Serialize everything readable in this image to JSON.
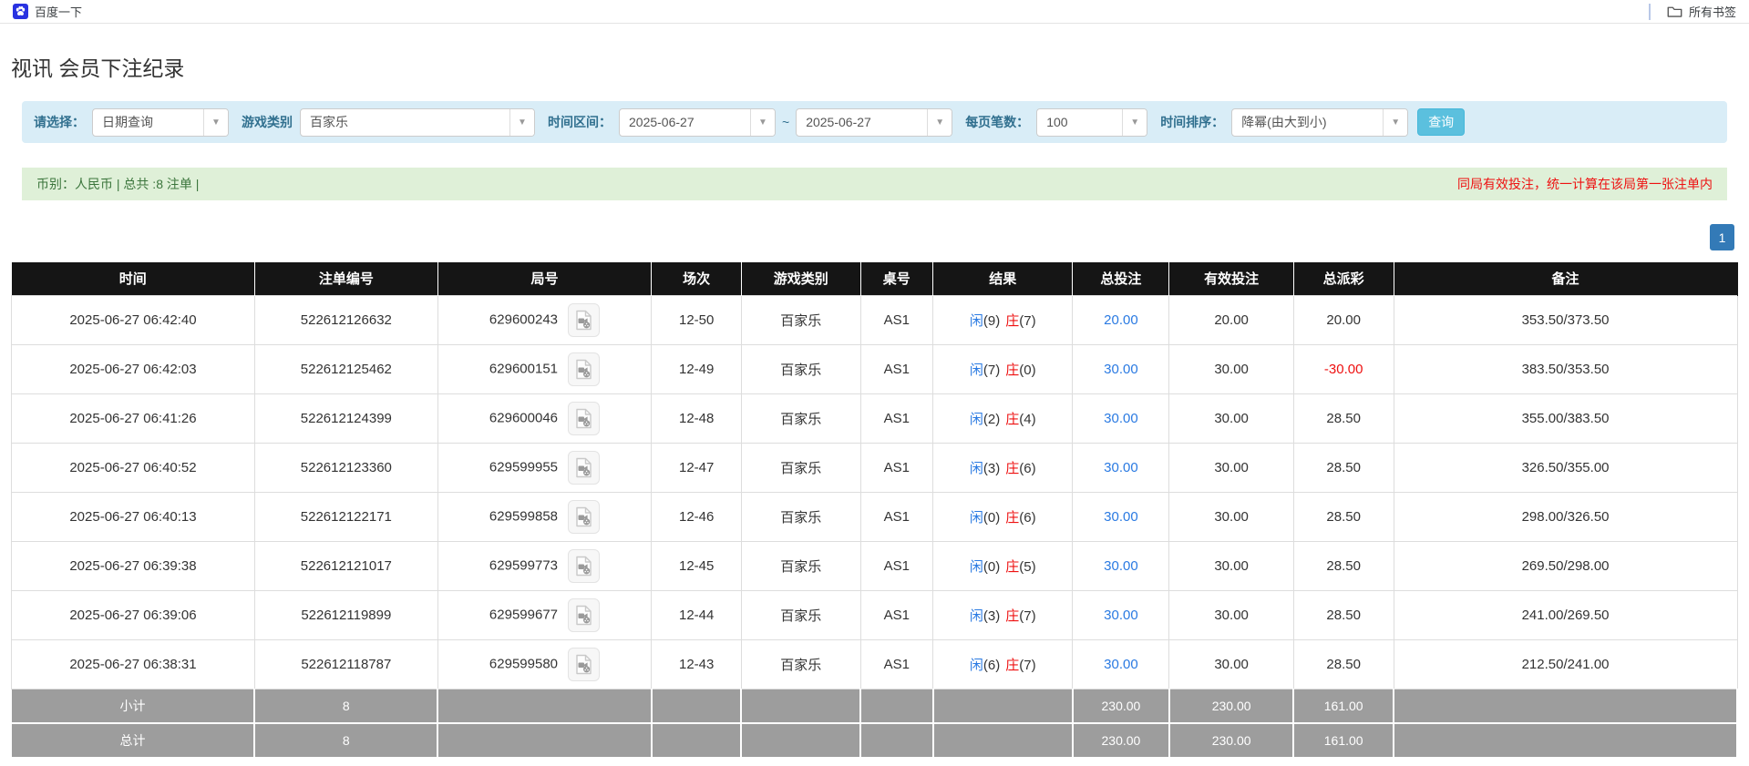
{
  "browser": {
    "bookmark_label": "百度一下",
    "all_bookmarks_label": "所有书签"
  },
  "page": {
    "title": "视讯 会员下注纪录"
  },
  "filters": {
    "select_label": "请选择：",
    "select_value": "日期查询",
    "game_type_label": "游戏类别",
    "game_type_value": "百家乐",
    "date_range_label": "时间区间：",
    "date_from": "2025-06-27",
    "date_separator": "~",
    "date_to": "2025-06-27",
    "page_size_label": "每页笔数：",
    "page_size_value": "100",
    "sort_label": "时间排序：",
    "sort_value": "降幂(由大到小)",
    "search_button_label": "查询"
  },
  "summary": {
    "left_text": "币别：人民币 | 总共 :8 注单 |",
    "right_text": "同局有效投注，统一计算在该局第一张注单内"
  },
  "pagination": {
    "current_page": "1"
  },
  "table": {
    "headers": [
      "时间",
      "注单编号",
      "局号",
      "场次",
      "游戏类别",
      "桌号",
      "结果",
      "总投注",
      "有效投注",
      "总派彩",
      "备注"
    ],
    "rows": [
      {
        "time": "2025-06-27 06:42:40",
        "bet_id": "522612126632",
        "round_id": "629600243",
        "session": "12-50",
        "game": "百家乐",
        "table": "AS1",
        "result": {
          "player_label": "闲",
          "player_score": "(9)",
          "banker_label": "庄",
          "banker_score": "(7)"
        },
        "total_bet": "20.00",
        "valid_bet": "20.00",
        "payout": "20.00",
        "remark": "353.50/373.50"
      },
      {
        "time": "2025-06-27 06:42:03",
        "bet_id": "522612125462",
        "round_id": "629600151",
        "session": "12-49",
        "game": "百家乐",
        "table": "AS1",
        "result": {
          "player_label": "闲",
          "player_score": "(7)",
          "banker_label": "庄",
          "banker_score": "(0)"
        },
        "total_bet": "30.00",
        "valid_bet": "30.00",
        "payout": "-30.00",
        "remark": "383.50/353.50"
      },
      {
        "time": "2025-06-27 06:41:26",
        "bet_id": "522612124399",
        "round_id": "629600046",
        "session": "12-48",
        "game": "百家乐",
        "table": "AS1",
        "result": {
          "player_label": "闲",
          "player_score": "(2)",
          "banker_label": "庄",
          "banker_score": "(4)"
        },
        "total_bet": "30.00",
        "valid_bet": "30.00",
        "payout": "28.50",
        "remark": "355.00/383.50"
      },
      {
        "time": "2025-06-27 06:40:52",
        "bet_id": "522612123360",
        "round_id": "629599955",
        "session": "12-47",
        "game": "百家乐",
        "table": "AS1",
        "result": {
          "player_label": "闲",
          "player_score": "(3)",
          "banker_label": "庄",
          "banker_score": "(6)"
        },
        "total_bet": "30.00",
        "valid_bet": "30.00",
        "payout": "28.50",
        "remark": "326.50/355.00"
      },
      {
        "time": "2025-06-27 06:40:13",
        "bet_id": "522612122171",
        "round_id": "629599858",
        "session": "12-46",
        "game": "百家乐",
        "table": "AS1",
        "result": {
          "player_label": "闲",
          "player_score": "(0)",
          "banker_label": "庄",
          "banker_score": "(6)"
        },
        "total_bet": "30.00",
        "valid_bet": "30.00",
        "payout": "28.50",
        "remark": "298.00/326.50"
      },
      {
        "time": "2025-06-27 06:39:38",
        "bet_id": "522612121017",
        "round_id": "629599773",
        "session": "12-45",
        "game": "百家乐",
        "table": "AS1",
        "result": {
          "player_label": "闲",
          "player_score": "(0)",
          "banker_label": "庄",
          "banker_score": "(5)"
        },
        "total_bet": "30.00",
        "valid_bet": "30.00",
        "payout": "28.50",
        "remark": "269.50/298.00"
      },
      {
        "time": "2025-06-27 06:39:06",
        "bet_id": "522612119899",
        "round_id": "629599677",
        "session": "12-44",
        "game": "百家乐",
        "table": "AS1",
        "result": {
          "player_label": "闲",
          "player_score": "(3)",
          "banker_label": "庄",
          "banker_score": "(7)"
        },
        "total_bet": "30.00",
        "valid_bet": "30.00",
        "payout": "28.50",
        "remark": "241.00/269.50"
      },
      {
        "time": "2025-06-27 06:38:31",
        "bet_id": "522612118787",
        "round_id": "629599580",
        "session": "12-43",
        "game": "百家乐",
        "table": "AS1",
        "result": {
          "player_label": "闲",
          "player_score": "(6)",
          "banker_label": "庄",
          "banker_score": "(7)"
        },
        "total_bet": "30.00",
        "valid_bet": "30.00",
        "payout": "28.50",
        "remark": "212.50/241.00"
      }
    ],
    "footer": [
      {
        "label": "小计",
        "count": "8",
        "total_bet": "230.00",
        "valid_bet": "230.00",
        "payout": "161.00"
      },
      {
        "label": "总计",
        "count": "8",
        "total_bet": "230.00",
        "valid_bet": "230.00",
        "payout": "161.00"
      }
    ]
  },
  "colors": {
    "filter_bar_bg": "#d9edf7",
    "filter_label": "#31708f",
    "search_button": "#5bc0de",
    "summary_bg": "#dff0d8",
    "summary_text": "#3c763d",
    "alert_red": "#ee1111",
    "link_blue": "#2a7ae2",
    "pagination_blue": "#337ab7",
    "header_bg": "#151515",
    "footer_bg": "#9d9d9d"
  }
}
